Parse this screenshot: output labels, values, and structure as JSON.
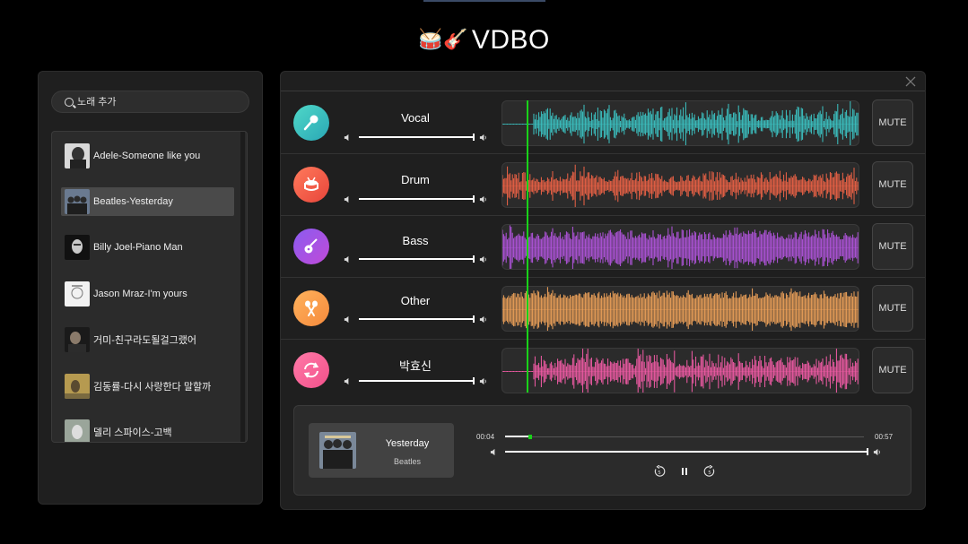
{
  "app": {
    "title": "VDBO",
    "logo_emoji": "🥁🎸"
  },
  "search": {
    "placeholder": "노래 추가"
  },
  "songs": [
    {
      "title": "Adele-Someone like you",
      "active": false
    },
    {
      "title": "Beatles-Yesterday",
      "active": true
    },
    {
      "title": "Billy Joel-Piano Man",
      "active": false
    },
    {
      "title": "Jason Mraz-I'm yours",
      "active": false
    },
    {
      "title": "거미-친구라도될걸그랬어",
      "active": false
    },
    {
      "title": "김동률-다시 사랑한다 말할까",
      "active": false
    },
    {
      "title": "델리 스파이스-고백",
      "active": false
    }
  ],
  "tracks": [
    {
      "name": "Vocal",
      "color": "#3cc6c6",
      "icon": "microphone-icon",
      "mute_label": "MUTE"
    },
    {
      "name": "Drum",
      "color": "#f06346",
      "icon": "drum-icon",
      "mute_label": "MUTE"
    },
    {
      "name": "Bass",
      "color": "#b455e0",
      "icon": "guitar-icon",
      "mute_label": "MUTE"
    },
    {
      "name": "Other",
      "color": "#f3a45a",
      "icon": "maracas-icon",
      "mute_label": "MUTE"
    },
    {
      "name": "박효신",
      "color": "#f55ca8",
      "icon": "refresh-icon",
      "mute_label": "MUTE"
    }
  ],
  "player": {
    "title": "Yesterday",
    "artist": "Beatles",
    "current_time": "00:04",
    "total_time": "00:57",
    "progress": 0.07,
    "volume": 1.0
  },
  "colors": {
    "accent": "#19d219",
    "background": "#000000",
    "panel": "#1f1f1f"
  }
}
